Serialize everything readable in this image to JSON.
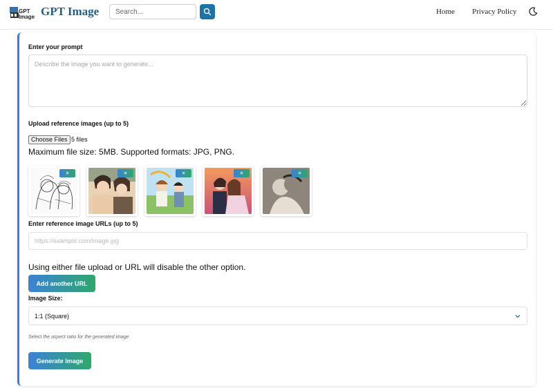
{
  "header": {
    "logo_text": "GPT Image",
    "brand": "GPT Image",
    "search_placeholder": "Search...",
    "nav": [
      {
        "label": "Home"
      },
      {
        "label": "Privacy Policy"
      }
    ],
    "accent_color": "#1b73a8"
  },
  "form": {
    "prompt_label": "Enter your prompt",
    "prompt_placeholder": "Describe the image you want to generate...",
    "upload_label": "Upload reference images (up to 5)",
    "choose_files_label": "Choose Files",
    "file_count": "5 files",
    "file_size_note": "Maximum file size: 5MB. Supported formats: JPG, PNG.",
    "thumbnails": [
      {
        "remove_label": "×",
        "icon": "line-sketch-couple-image"
      },
      {
        "remove_label": "×",
        "icon": "anime-couple-image"
      },
      {
        "remove_label": "×",
        "icon": "anime-couple-field-image"
      },
      {
        "remove_label": "×",
        "icon": "anime-couple-sunset-image"
      },
      {
        "remove_label": "×",
        "icon": "pencil-sketch-embrace-image"
      }
    ],
    "url_label": "Enter reference image URLs (up to 5)",
    "url_placeholder": "https://example.com/image.jpg",
    "exclusive_note": "Using either file upload or URL will disable the other option.",
    "add_url_label": "Add another URL",
    "size_label": "Image Size:",
    "size_value": "1:1 (Square)",
    "size_helper": "Select the aspect ratio for the generated image",
    "generate_label": "Generate Image",
    "button_gradient": [
      "#3b82d6",
      "#2fa86a"
    ]
  }
}
